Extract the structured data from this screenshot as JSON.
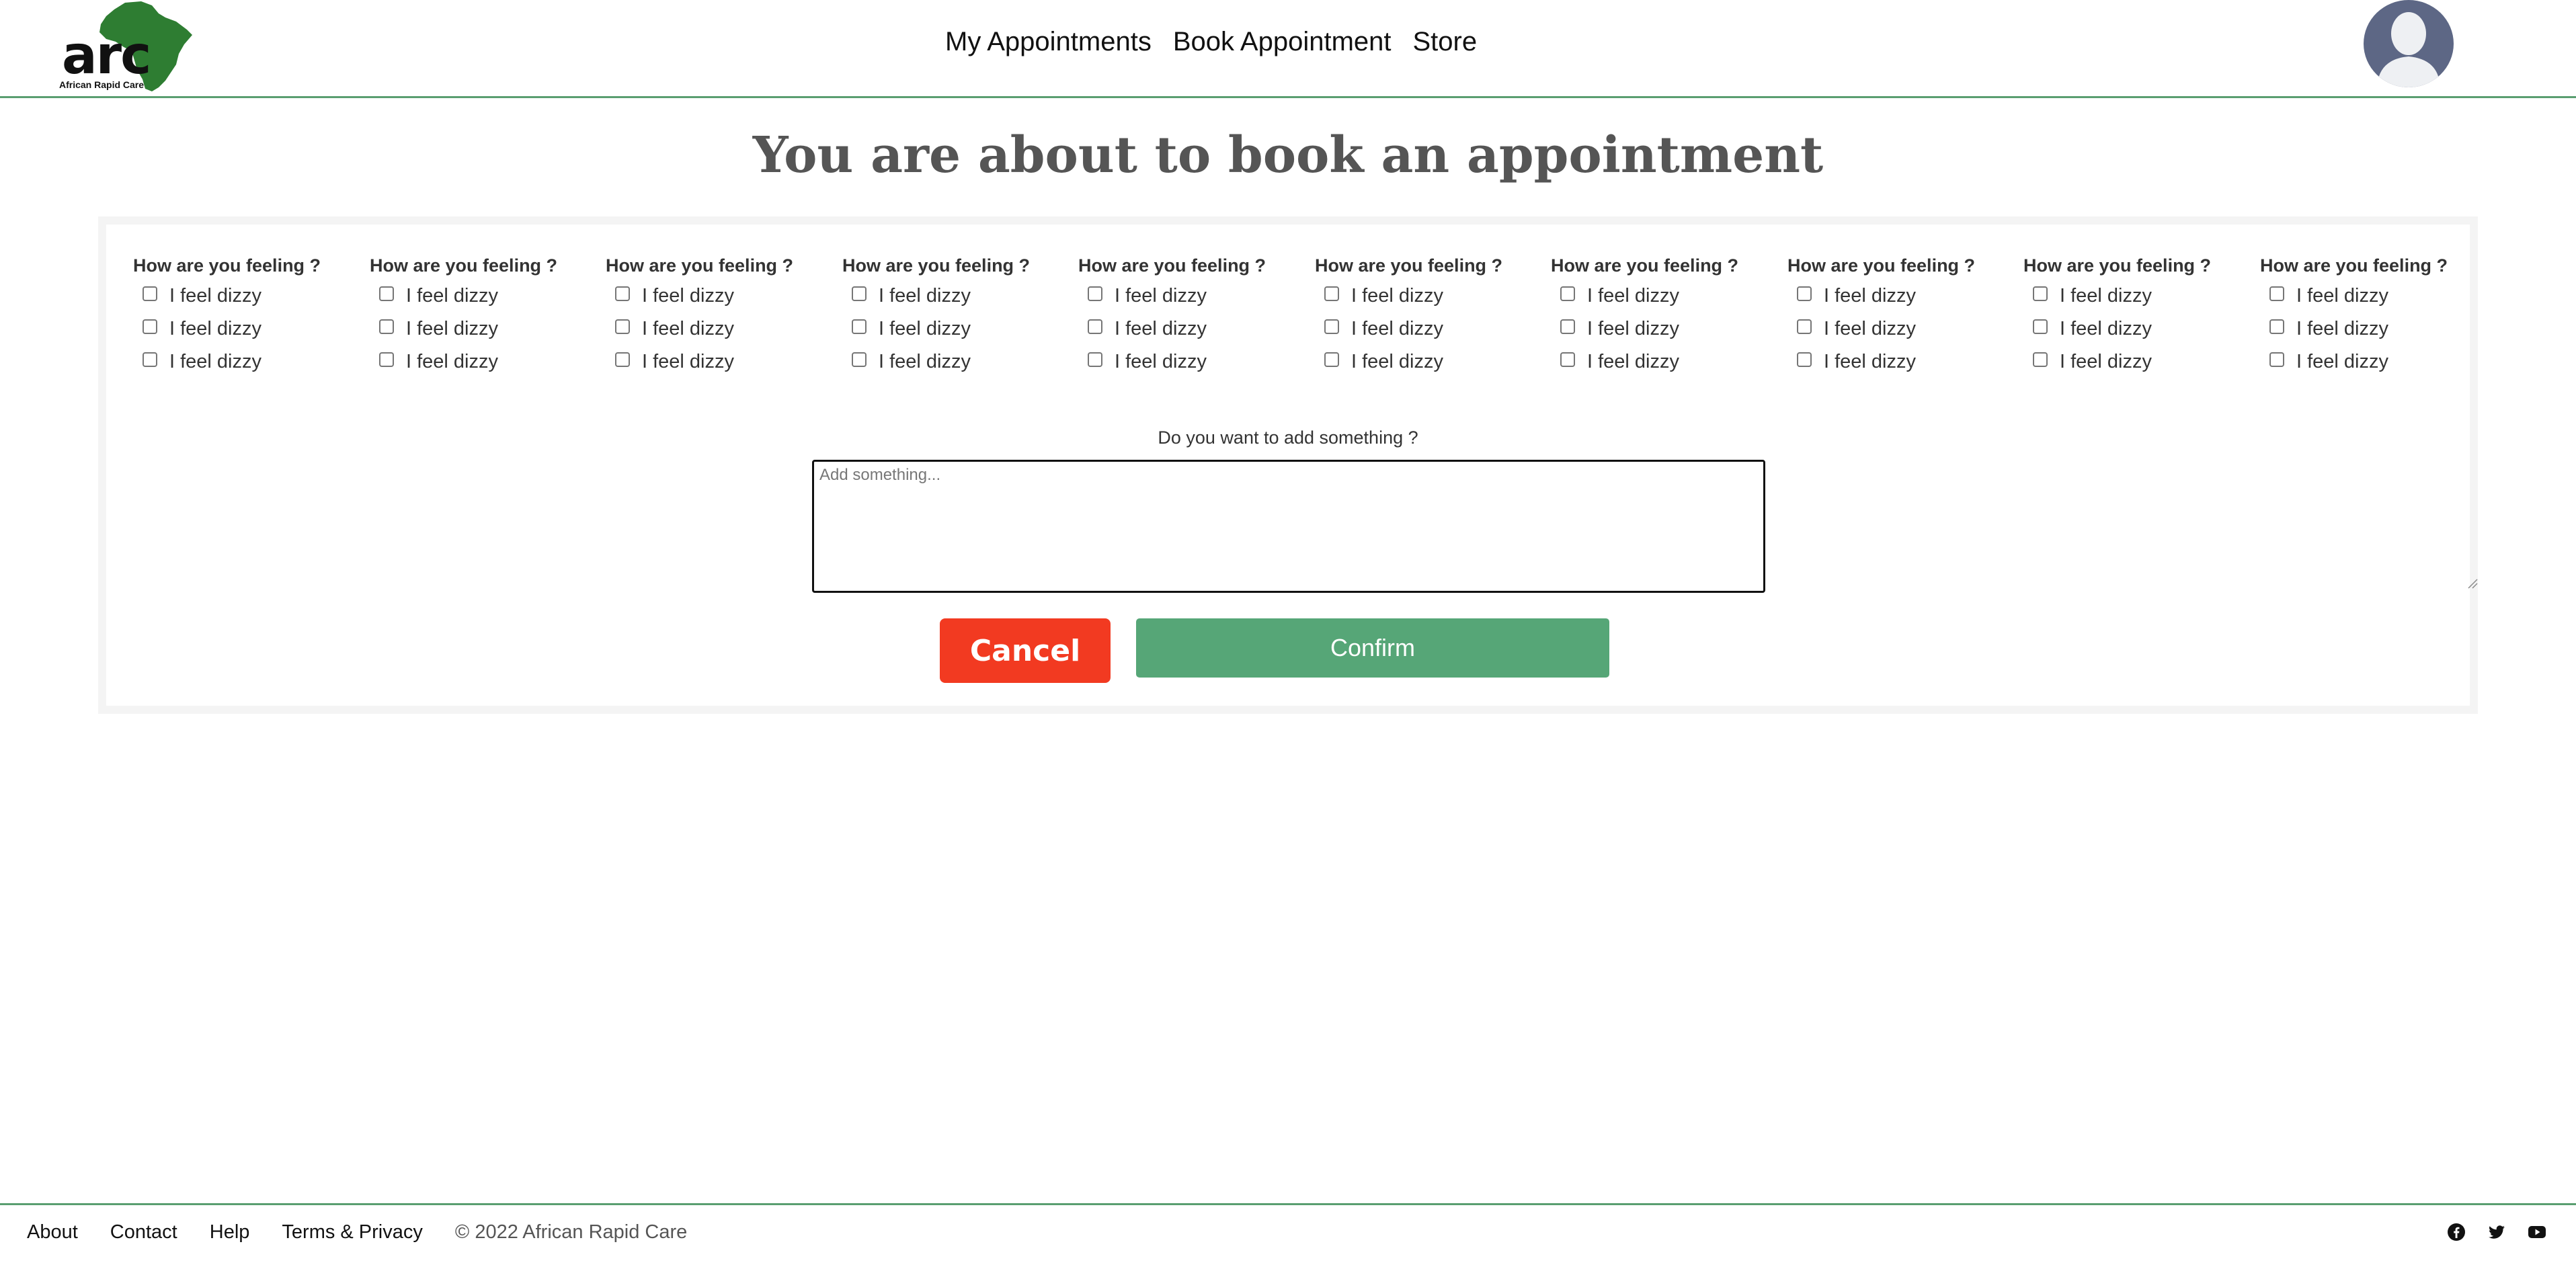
{
  "header": {
    "logo_text": "arc",
    "logo_subtitle": "African Rapid Care",
    "nav": [
      "My Appointments",
      "Book Appointment",
      "Store"
    ]
  },
  "page_title": "You are about to book an appointment",
  "questions": [
    {
      "title": "How are you feeling ?",
      "options": [
        "I feel dizzy",
        "I feel dizzy",
        "I feel dizzy"
      ]
    },
    {
      "title": "How are you feeling ?",
      "options": [
        "I feel dizzy",
        "I feel dizzy",
        "I feel dizzy"
      ]
    },
    {
      "title": "How are you feeling ?",
      "options": [
        "I feel dizzy",
        "I feel dizzy",
        "I feel dizzy"
      ]
    },
    {
      "title": "How are you feeling ?",
      "options": [
        "I feel dizzy",
        "I feel dizzy",
        "I feel dizzy"
      ]
    },
    {
      "title": "How are you feeling ?",
      "options": [
        "I feel dizzy",
        "I feel dizzy",
        "I feel dizzy"
      ]
    },
    {
      "title": "How are you feeling ?",
      "options": [
        "I feel dizzy",
        "I feel dizzy",
        "I feel dizzy"
      ]
    },
    {
      "title": "How are you feeling ?",
      "options": [
        "I feel dizzy",
        "I feel dizzy",
        "I feel dizzy"
      ]
    },
    {
      "title": "How are you feeling ?",
      "options": [
        "I feel dizzy",
        "I feel dizzy",
        "I feel dizzy"
      ]
    },
    {
      "title": "How are you feeling ?",
      "options": [
        "I feel dizzy",
        "I feel dizzy",
        "I feel dizzy"
      ]
    },
    {
      "title": "How are you feeling ?",
      "options": [
        "I feel dizzy",
        "I feel dizzy",
        "I feel dizzy"
      ]
    }
  ],
  "add_something": {
    "label": "Do you want to add something ?",
    "placeholder": "Add something...",
    "value": ""
  },
  "buttons": {
    "cancel": "Cancel",
    "confirm": "Confirm"
  },
  "footer": {
    "links": [
      "About",
      "Contact",
      "Help",
      "Terms & Privacy"
    ],
    "copyright": "© 2022 African Rapid Care",
    "socials": [
      "facebook-icon",
      "twitter-icon",
      "youtube-icon"
    ]
  },
  "colors": {
    "accent_green": "#56a677",
    "rule_green": "#5a9e70",
    "cancel_red": "#f23a21",
    "logo_green": "#2e7d32",
    "avatar_bg": "#5d6785"
  }
}
